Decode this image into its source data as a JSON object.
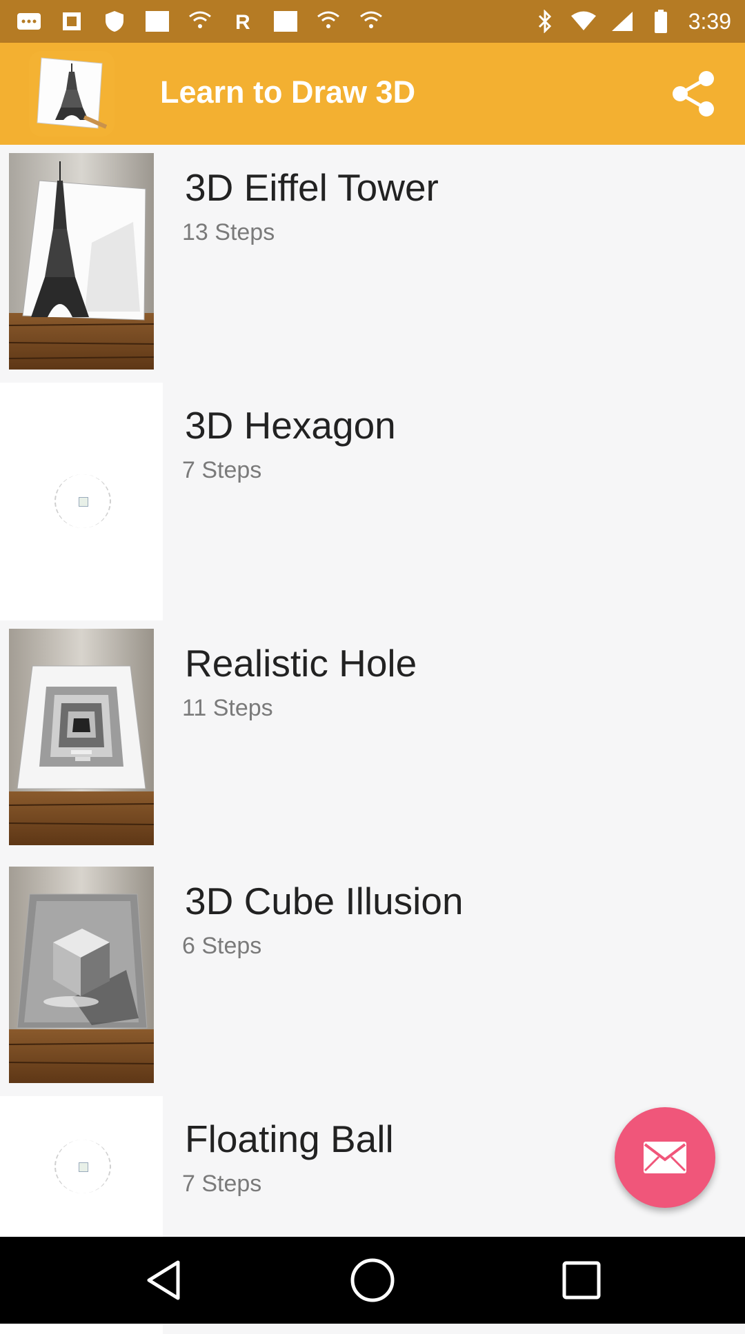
{
  "status_bar": {
    "time": "3:39",
    "left_icons": [
      "more-icon",
      "image-icon",
      "shield-icon",
      "wifi-icon",
      "image-icon",
      "wifi-icon",
      "r-icon",
      "wifi-icon",
      "square-icon",
      "wifi-icon",
      "wifi-icon",
      "wifi-icon"
    ],
    "right_icons": [
      "bluetooth-icon",
      "wifi-icon",
      "signal-icon",
      "battery-icon"
    ]
  },
  "app_bar": {
    "title": "Learn to Draw 3D",
    "logo_icon": "eiffel-drawing-logo",
    "share_icon": "share-icon"
  },
  "items": [
    {
      "title": "3D Eiffel Tower",
      "steps": "13 Steps",
      "thumb": "eiffel"
    },
    {
      "title": "3D Hexagon",
      "steps": "7 Steps",
      "thumb": "broken"
    },
    {
      "title": "Realistic Hole",
      "steps": "11 Steps",
      "thumb": "hole"
    },
    {
      "title": "3D Cube Illusion",
      "steps": "6 Steps",
      "thumb": "cube"
    },
    {
      "title": "Floating Ball",
      "steps": "7 Steps",
      "thumb": "broken"
    }
  ],
  "fab": {
    "icon": "mail-icon"
  },
  "nav_bar": {
    "icons": [
      "back-icon",
      "home-icon",
      "recents-icon"
    ]
  },
  "colors": {
    "status_bar": "#b57b24",
    "app_bar": "#f3b031",
    "fab": "#f0567a",
    "list_bg": "#f6f6f7"
  }
}
